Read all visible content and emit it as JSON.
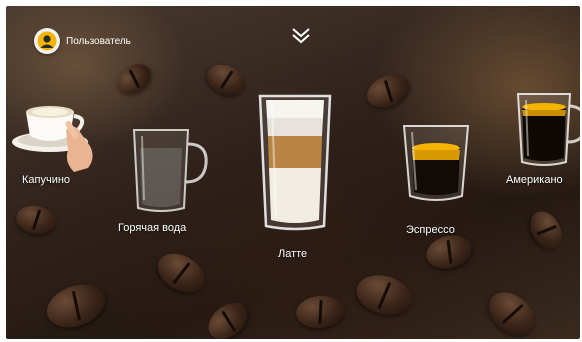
{
  "user": {
    "name": "Пользователь",
    "icon": "user-avatar-icon"
  },
  "header": {
    "expand_icon": "chevron-down-double-icon"
  },
  "drinks": [
    {
      "label": "Капучино",
      "icon": "cappuccino-cup-icon"
    },
    {
      "label": "Горячая вода",
      "icon": "hot-water-glass-icon"
    },
    {
      "label": "Латте",
      "icon": "latte-glass-icon",
      "selected": true
    },
    {
      "label": "Эспрессо",
      "icon": "espresso-glass-icon"
    },
    {
      "label": "Американо",
      "icon": "americano-glass-icon"
    }
  ],
  "colors": {
    "accent": "#f5b400",
    "text": "#ffffff"
  }
}
